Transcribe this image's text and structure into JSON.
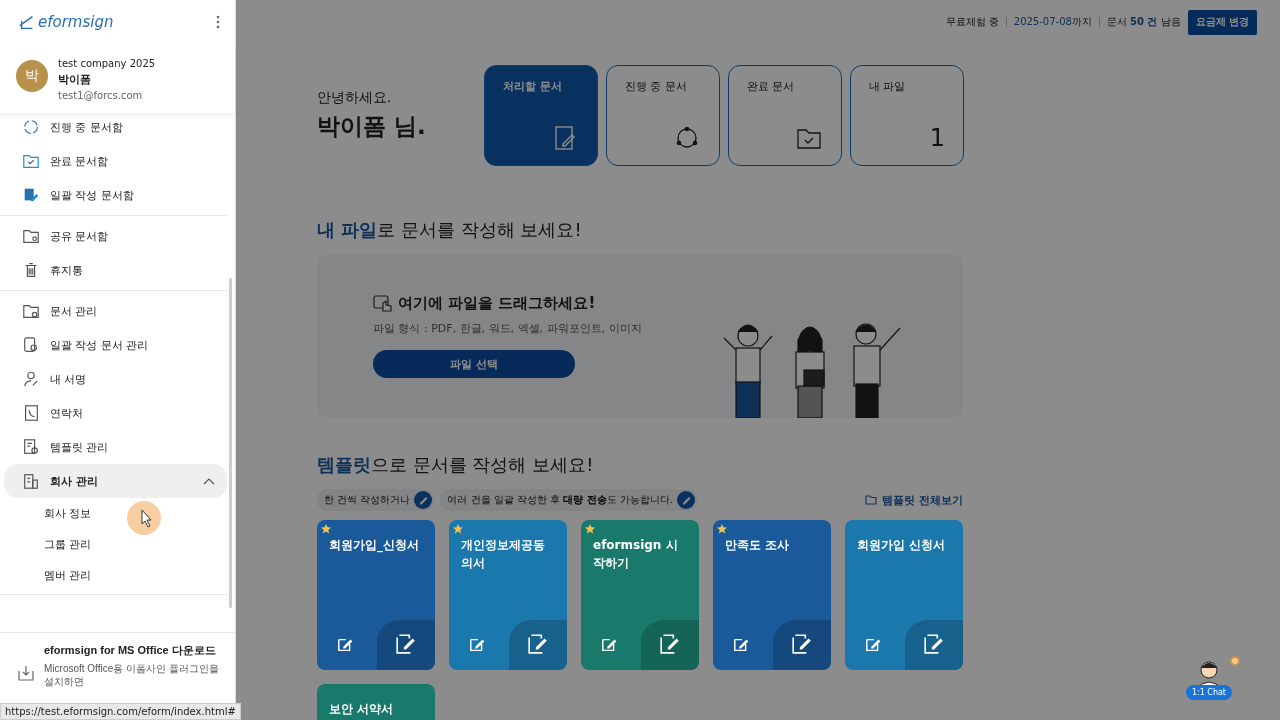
{
  "sidebar": {
    "logo": "eformsign",
    "profile": {
      "initial": "박",
      "company": "test company 2025",
      "name": "박이폼",
      "email": "test1@forcs.com"
    },
    "sections": [
      {
        "items": [
          {
            "label": "진행 중 문서함"
          },
          {
            "label": "완료 문서함"
          },
          {
            "label": "일괄 작성 문서함"
          }
        ]
      },
      {
        "items": [
          {
            "label": "공유 문서함"
          },
          {
            "label": "휴지통"
          }
        ]
      },
      {
        "items": [
          {
            "label": "문서 관리"
          },
          {
            "label": "일괄 작성 문서 관리"
          },
          {
            "label": "내 서명"
          },
          {
            "label": "연락처"
          },
          {
            "label": "템플릿 관리"
          },
          {
            "label": "회사 관리",
            "expanded": true,
            "children": [
              {
                "label": "회사 정보"
              },
              {
                "label": "그룹 관리"
              },
              {
                "label": "멤버 관리"
              }
            ]
          }
        ]
      }
    ],
    "footer": {
      "title": "eformsign for MS Office 다운로드",
      "description": "Microsoft Office용 이폼사인 플러그인을 설치하면"
    }
  },
  "top_bar": {
    "trial": "무료체험 중",
    "expiry_date": "2025-07-08",
    "expiry_suffix": "까지",
    "remaining": "문서 **50 건** 남음",
    "button": "요금제 변경"
  },
  "greeting": {
    "hello": "안녕하세요.",
    "name": "박이폼 님."
  },
  "summary_cards": [
    {
      "label": "처리할 문서",
      "selected": true
    },
    {
      "label": "진행 중 문서",
      "selected": false
    },
    {
      "label": "완료 문서",
      "selected": false
    },
    {
      "label": "내 파일",
      "selected": false,
      "count": "1"
    }
  ],
  "my_files": {
    "heading": "**내 파일**로 문서를 작성해 보세요!",
    "drop_title": "여기에 파일을 드래그하세요!",
    "formats": "파일 형식 : PDF, 한글, 워드, 엑셀, 파워포인트, 이미지",
    "button": "파일 선택"
  },
  "templates": {
    "heading": "**템플릿**으로 문서를 작성해 보세요!",
    "hints": [
      "한 건씩 작성하거나",
      "여러 건을 일괄 작성한 후 **대량 전송**도 가능합니다."
    ],
    "view_all": "템플릿 전체보기",
    "cards": [
      {
        "title": "회원가입_신청서",
        "favorite": true,
        "color": "#1a5a9a"
      },
      {
        "title": "개인정보제공동의서",
        "favorite": true,
        "color": "#1b78ad"
      },
      {
        "title": "eformsign 시작하기",
        "favorite": true,
        "color": "#197a6c"
      },
      {
        "title": "만족도 조사",
        "favorite": true,
        "color": "#1a5a9a"
      },
      {
        "title": "회원가입 신청서",
        "favorite": false,
        "color": "#1b78ad"
      },
      {
        "title": "보안 서약서",
        "favorite": false,
        "color": "#197a6c"
      }
    ]
  },
  "chat": {
    "label": "1:1 Chat"
  },
  "status_url": "https://test.eformsign.com/eform/index.html#"
}
